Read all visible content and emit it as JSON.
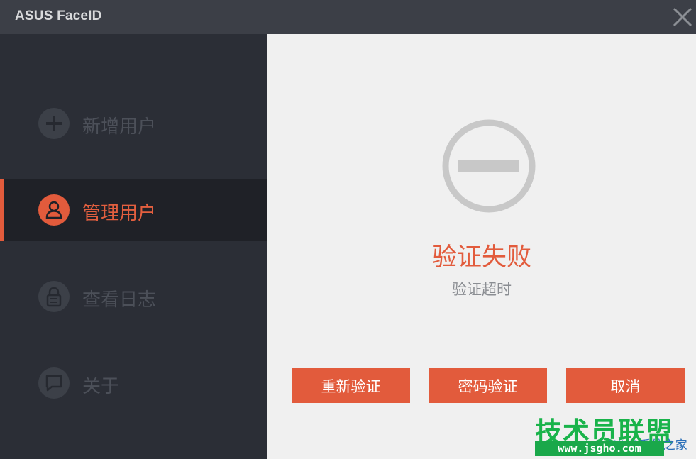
{
  "window": {
    "title": "ASUS FaceID",
    "close_icon": "close-icon"
  },
  "sidebar": {
    "items": [
      {
        "label": "新增用户",
        "icon": "plus-circle-icon",
        "active": false
      },
      {
        "label": "管理用户",
        "icon": "user-icon",
        "active": true
      },
      {
        "label": "查看日志",
        "icon": "lock-icon",
        "active": false
      },
      {
        "label": "关于",
        "icon": "chat-icon",
        "active": false
      }
    ]
  },
  "main": {
    "status_icon": "minus-circle-icon",
    "status_title": "验证失败",
    "status_subtitle": "验证超时",
    "buttons": {
      "retry": "重新验证",
      "password": "密码验证",
      "cancel": "取消"
    }
  },
  "watermark": {
    "main": "技术员联盟",
    "url": "www.jsgho.com",
    "side": "Win8系统之家"
  },
  "colors": {
    "accent": "#e25b3c",
    "titlebar": "#3c3f47",
    "sidebar": "#2b2e36",
    "sidebar_active": "#1f2127",
    "content_bg": "#f0f0f0"
  }
}
